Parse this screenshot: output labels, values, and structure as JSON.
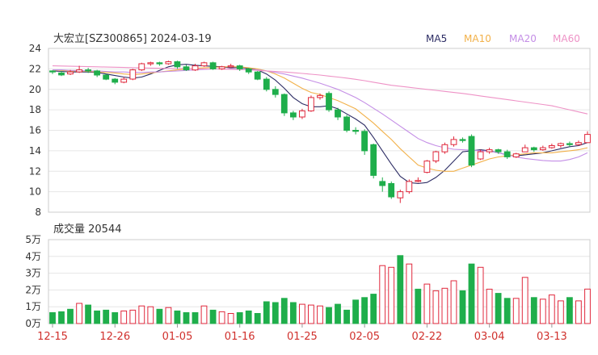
{
  "header": {
    "title": "大宏立[SZ300865] 2024-03-19",
    "volume_title": "成交量 20544"
  },
  "legend": [
    {
      "label": "MA5",
      "color": "#2c2c64"
    },
    {
      "label": "MA10",
      "color": "#f2b14a"
    },
    {
      "label": "MA20",
      "color": "#c48ee6"
    },
    {
      "label": "MA60",
      "color": "#ee92c6"
    }
  ],
  "colors": {
    "up": "#e0283c",
    "down": "#1fae4b"
  },
  "chart_data": [
    {
      "type": "candlestick",
      "title": "大宏立[SZ300865] 2024-03-19",
      "ylim": [
        8,
        24
      ],
      "yticks": [
        "24",
        "22",
        "20",
        "18",
        "16",
        "14",
        "12",
        "10",
        "8"
      ],
      "xticks": [
        {
          "label": "12-15",
          "index": 0
        },
        {
          "label": "12-26",
          "index": 7
        },
        {
          "label": "01-05",
          "index": 14
        },
        {
          "label": "01-16",
          "index": 21
        },
        {
          "label": "01-25",
          "index": 28
        },
        {
          "label": "02-05",
          "index": 35
        },
        {
          "label": "02-22",
          "index": 42
        },
        {
          "label": "03-04",
          "index": 49
        },
        {
          "label": "03-13",
          "index": 56
        }
      ],
      "ohlc": [
        [
          21.8,
          21.7,
          21.85,
          21.5
        ],
        [
          21.6,
          21.4,
          21.8,
          21.3
        ],
        [
          21.5,
          21.7,
          21.9,
          21.4
        ],
        [
          21.7,
          21.9,
          22.3,
          21.6
        ],
        [
          21.9,
          21.8,
          22.1,
          21.6
        ],
        [
          21.8,
          21.4,
          21.9,
          21.2
        ],
        [
          21.4,
          21.0,
          21.5,
          20.9
        ],
        [
          21.0,
          20.7,
          21.1,
          20.5
        ],
        [
          20.7,
          21.0,
          21.2,
          20.6
        ],
        [
          21.0,
          21.9,
          22.0,
          20.9
        ],
        [
          21.9,
          22.5,
          22.6,
          21.8
        ],
        [
          22.5,
          22.6,
          22.7,
          22.3
        ],
        [
          22.6,
          22.5,
          22.7,
          22.3
        ],
        [
          22.5,
          22.7,
          22.8,
          22.4
        ],
        [
          22.7,
          22.2,
          22.8,
          22.0
        ],
        [
          22.2,
          21.9,
          22.4,
          21.8
        ],
        [
          21.9,
          22.3,
          22.5,
          21.8
        ],
        [
          22.3,
          22.6,
          22.7,
          22.2
        ],
        [
          22.6,
          22.0,
          22.7,
          21.9
        ],
        [
          22.0,
          22.2,
          22.3,
          21.9
        ],
        [
          22.2,
          22.3,
          22.5,
          22.1
        ],
        [
          22.3,
          22.0,
          22.4,
          21.8
        ],
        [
          22.0,
          21.7,
          22.1,
          21.5
        ],
        [
          21.7,
          21.0,
          21.8,
          20.9
        ],
        [
          21.0,
          20.0,
          21.2,
          19.8
        ],
        [
          20.0,
          19.5,
          20.3,
          19.2
        ],
        [
          19.5,
          17.7,
          19.6,
          17.4
        ],
        [
          17.7,
          17.3,
          17.9,
          17.0
        ],
        [
          17.3,
          17.9,
          18.1,
          17.1
        ],
        [
          17.9,
          19.2,
          19.4,
          17.8
        ],
        [
          19.2,
          19.4,
          19.6,
          19.0
        ],
        [
          19.6,
          18.0,
          19.8,
          17.8
        ],
        [
          18.0,
          17.3,
          18.2,
          17.0
        ],
        [
          17.3,
          16.0,
          17.5,
          15.8
        ],
        [
          16.0,
          15.9,
          16.3,
          15.6
        ],
        [
          15.9,
          14.0,
          16.1,
          13.6
        ],
        [
          14.6,
          11.6,
          14.7,
          11.3
        ],
        [
          11.0,
          10.6,
          11.4,
          10.0
        ],
        [
          10.8,
          9.5,
          11.0,
          9.3
        ],
        [
          9.4,
          10.0,
          10.2,
          8.9
        ],
        [
          10.0,
          11.0,
          11.2,
          9.8
        ],
        [
          11.0,
          11.1,
          11.4,
          10.9
        ],
        [
          11.9,
          13.0,
          13.1,
          11.8
        ],
        [
          13.0,
          13.9,
          14.0,
          12.8
        ],
        [
          13.9,
          14.6,
          14.8,
          13.7
        ],
        [
          14.6,
          15.1,
          15.4,
          14.4
        ],
        [
          15.1,
          15.0,
          15.3,
          14.8
        ],
        [
          15.4,
          12.6,
          15.6,
          12.4
        ],
        [
          13.2,
          13.9,
          14.1,
          13.1
        ],
        [
          13.9,
          14.1,
          14.3,
          13.7
        ],
        [
          14.1,
          13.9,
          14.2,
          13.7
        ],
        [
          13.9,
          13.4,
          14.1,
          13.2
        ],
        [
          13.4,
          13.7,
          13.8,
          13.3
        ],
        [
          13.9,
          14.3,
          14.6,
          13.9
        ],
        [
          14.3,
          14.1,
          14.4,
          13.9
        ],
        [
          14.1,
          14.3,
          14.5,
          14.0
        ],
        [
          14.3,
          14.5,
          14.7,
          14.2
        ],
        [
          14.5,
          14.7,
          14.8,
          14.3
        ],
        [
          14.7,
          14.6,
          14.9,
          14.4
        ],
        [
          14.6,
          14.8,
          15.0,
          14.5
        ],
        [
          14.8,
          15.6,
          15.9,
          14.8
        ]
      ],
      "series": [
        {
          "name": "MA5",
          "values": [
            21.8,
            21.75,
            21.7,
            21.7,
            21.7,
            21.65,
            21.5,
            21.35,
            21.2,
            21.1,
            21.2,
            21.5,
            21.85,
            22.2,
            22.4,
            22.45,
            22.35,
            22.3,
            22.25,
            22.2,
            22.1,
            22.15,
            22.05,
            21.9,
            21.5,
            20.9,
            20.1,
            19.2,
            18.6,
            18.3,
            18.3,
            18.4,
            18.1,
            17.6,
            17.1,
            16.5,
            15.3,
            14.0,
            12.7,
            11.5,
            10.9,
            10.8,
            10.9,
            11.4,
            12.1,
            13.0,
            13.9,
            14.0,
            14.1,
            14.0,
            13.8,
            13.6,
            13.5,
            13.6,
            13.7,
            13.8,
            14.0,
            14.2,
            14.4,
            14.5,
            14.8
          ]
        },
        {
          "name": "MA10",
          "values": [
            21.9,
            21.85,
            21.8,
            21.8,
            21.75,
            21.7,
            21.65,
            21.6,
            21.5,
            21.45,
            21.5,
            21.6,
            21.7,
            21.8,
            21.9,
            22.0,
            22.05,
            22.1,
            22.15,
            22.2,
            22.2,
            22.2,
            22.1,
            22.0,
            21.8,
            21.5,
            21.1,
            20.6,
            20.1,
            19.7,
            19.5,
            19.2,
            18.9,
            18.5,
            18.1,
            17.4,
            16.7,
            15.9,
            15.1,
            14.2,
            13.4,
            12.6,
            12.3,
            12.1,
            12.0,
            12.0,
            12.3,
            12.6,
            12.9,
            13.2,
            13.4,
            13.5,
            13.6,
            13.7,
            13.8,
            13.8,
            13.8,
            13.9,
            14.0,
            14.1,
            14.3
          ]
        },
        {
          "name": "MA20",
          "values": [
            21.9,
            21.9,
            21.85,
            21.85,
            21.8,
            21.8,
            21.75,
            21.7,
            21.7,
            21.65,
            21.65,
            21.7,
            21.7,
            21.75,
            21.8,
            21.85,
            21.9,
            21.95,
            22.0,
            22.0,
            22.0,
            22.0,
            21.95,
            21.9,
            21.8,
            21.65,
            21.5,
            21.3,
            21.1,
            20.85,
            20.6,
            20.3,
            20.0,
            19.6,
            19.2,
            18.7,
            18.15,
            17.6,
            17.0,
            16.4,
            15.8,
            15.2,
            14.8,
            14.5,
            14.3,
            14.15,
            14.1,
            14.05,
            14.0,
            13.95,
            13.8,
            13.6,
            13.4,
            13.25,
            13.15,
            13.05,
            13.0,
            13.0,
            13.15,
            13.4,
            13.8
          ]
        },
        {
          "name": "MA60",
          "values": [
            22.3,
            22.28,
            22.26,
            22.24,
            22.22,
            22.2,
            22.18,
            22.16,
            22.14,
            22.12,
            22.1,
            22.08,
            22.06,
            22.04,
            22.03,
            22.02,
            22.01,
            22.0,
            21.99,
            21.98,
            21.96,
            21.94,
            21.9,
            21.85,
            21.8,
            21.75,
            21.7,
            21.63,
            21.56,
            21.48,
            21.4,
            21.3,
            21.2,
            21.1,
            20.98,
            20.85,
            20.7,
            20.55,
            20.4,
            20.3,
            20.2,
            20.1,
            20.0,
            19.9,
            19.8,
            19.7,
            19.6,
            19.48,
            19.36,
            19.24,
            19.12,
            19.0,
            18.88,
            18.76,
            18.64,
            18.52,
            18.4,
            18.2,
            18.0,
            17.8,
            17.6
          ]
        }
      ]
    },
    {
      "type": "bar",
      "title": "成交量 20544",
      "ylim": [
        0,
        50000
      ],
      "yticks": [
        "5万",
        "4万",
        "3万",
        "2万",
        "1万",
        "0万"
      ],
      "values": [
        6500,
        7000,
        8500,
        12000,
        11000,
        7500,
        8000,
        6500,
        7500,
        8000,
        10500,
        10000,
        8500,
        9500,
        7500,
        6500,
        6500,
        10500,
        8000,
        7000,
        6000,
        6500,
        7500,
        6000,
        13000,
        12500,
        15000,
        12500,
        11500,
        11000,
        10500,
        9500,
        11500,
        8000,
        14000,
        15500,
        17500,
        34500,
        33500,
        40500,
        35500,
        20500,
        23500,
        19500,
        21000,
        25500,
        19500,
        35500,
        33500,
        20500,
        18000,
        15000,
        15000,
        27500,
        15500,
        14500,
        17000,
        13500,
        15500,
        13500,
        20544
      ],
      "up": [
        false,
        false,
        false,
        true,
        false,
        false,
        false,
        false,
        true,
        true,
        true,
        true,
        false,
        true,
        false,
        false,
        false,
        true,
        false,
        true,
        true,
        false,
        false,
        false,
        false,
        false,
        false,
        false,
        true,
        true,
        true,
        false,
        false,
        false,
        false,
        false,
        false,
        true,
        true,
        false,
        true,
        false,
        true,
        true,
        true,
        true,
        false,
        false,
        true,
        true,
        false,
        false,
        true,
        true,
        false,
        true,
        true,
        true,
        false,
        true,
        true
      ]
    }
  ]
}
